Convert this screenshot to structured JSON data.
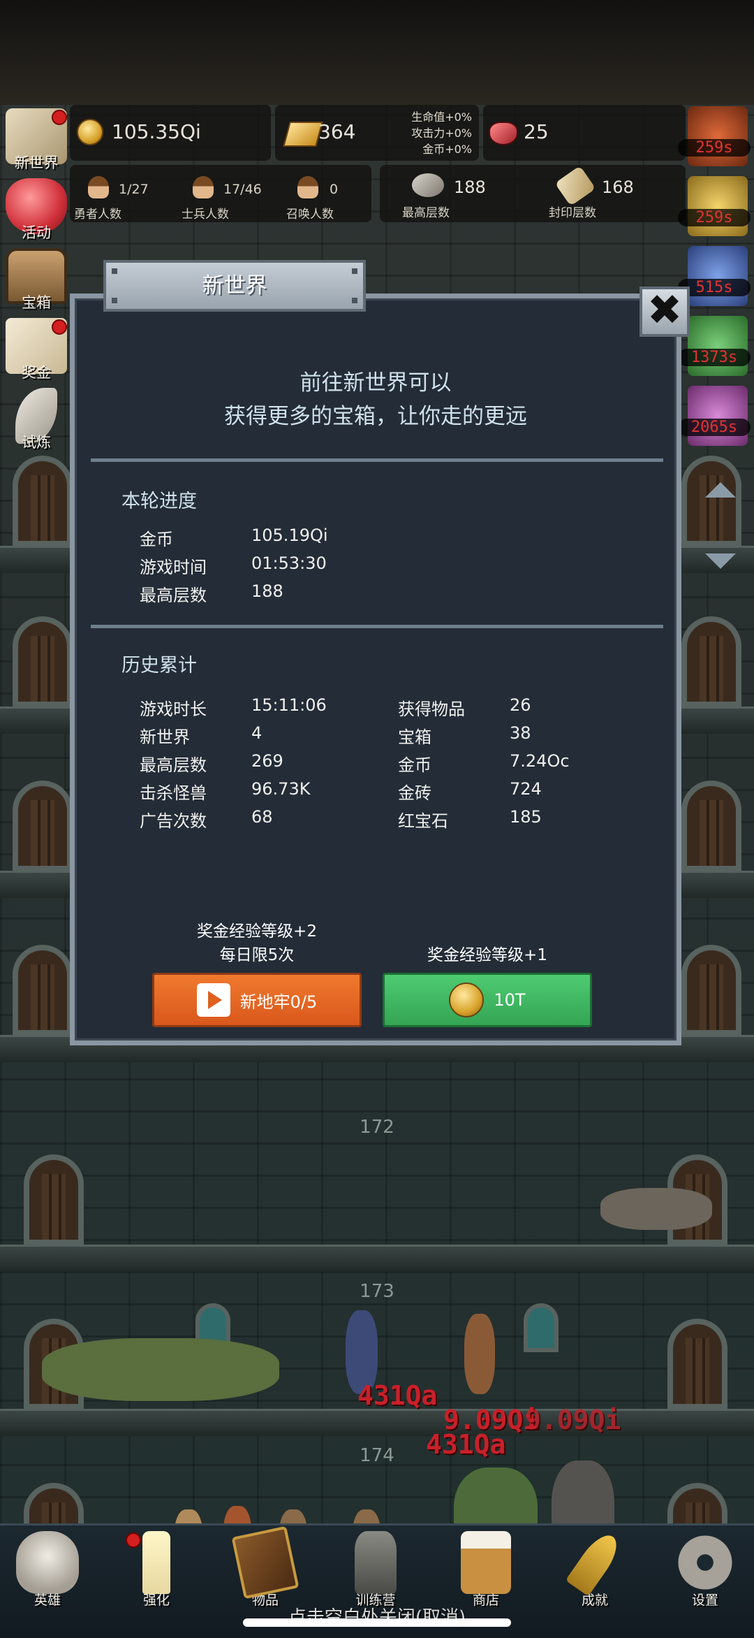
{
  "hud": {
    "coins": "105.35Qi",
    "gold_bars": "364",
    "bonus": [
      "生命值+0%",
      "攻击力+0%",
      "金币+0%"
    ],
    "rubies": "25",
    "heroes": {
      "value": "1/27",
      "label": "勇者人数"
    },
    "soldiers": {
      "value": "17/46",
      "label": "士兵人数"
    },
    "summons": {
      "value": "0",
      "label": "召唤人数"
    },
    "max_floor": {
      "value": "188",
      "label": "最高层数"
    },
    "sealed_floor": {
      "value": "168",
      "label": "封印层数"
    }
  },
  "side_menu": [
    {
      "label": "新世界",
      "icon": "map-icon",
      "dot": true
    },
    {
      "label": "活动",
      "icon": "heart-icon",
      "dot": false
    },
    {
      "label": "宝箱",
      "icon": "chest-icon",
      "dot": false
    },
    {
      "label": "奖金",
      "icon": "letter-icon",
      "dot": true
    },
    {
      "label": "试炼",
      "icon": "feather-icon",
      "dot": false
    }
  ],
  "buffs": [
    {
      "timer": "259s",
      "color": "#a04020"
    },
    {
      "timer": "259s",
      "color": "#b08a2a"
    },
    {
      "timer": "515s",
      "color": "#3c5a9c"
    },
    {
      "timer": "1373s",
      "color": "#3a8a3a"
    },
    {
      "timer": "2065s",
      "color": "#8a3a8a"
    }
  ],
  "dialog": {
    "title": "新世界",
    "close": "✖",
    "intro": [
      "前往新世界可以",
      "获得更多的宝箱，让你走的更远"
    ],
    "current": {
      "title": "本轮进度",
      "rows": [
        {
          "k": "金币",
          "v": "105.19Qi"
        },
        {
          "k": "游戏时间",
          "v": "01:53:30"
        },
        {
          "k": "最高层数",
          "v": "188"
        }
      ]
    },
    "history": {
      "title": "历史累计",
      "left": [
        {
          "k": "游戏时长",
          "v": "15:11:06"
        },
        {
          "k": "新世界",
          "v": "4"
        },
        {
          "k": "最高层数",
          "v": "269"
        },
        {
          "k": "击杀怪兽",
          "v": "96.73K"
        },
        {
          "k": "广告次数",
          "v": "68"
        }
      ],
      "right": [
        {
          "k": "获得物品",
          "v": "26"
        },
        {
          "k": "宝箱",
          "v": "38"
        },
        {
          "k": "金币",
          "v": "7.24Oc"
        },
        {
          "k": "金砖",
          "v": "724"
        },
        {
          "k": "红宝石",
          "v": "185"
        }
      ]
    },
    "ad_note": [
      "奖金经验等级+2",
      "每日限5次"
    ],
    "ad_button": "新地牢0/5",
    "coin_note": "奖金经验等级+1",
    "coin_button": "10T"
  },
  "floors": [
    "172",
    "173",
    "174"
  ],
  "damage": [
    "431Qa",
    "9.09Qi",
    "9.09Qi",
    "431Qa"
  ],
  "nav": [
    {
      "label": "英雄",
      "icon": "skull-icon",
      "dot": false
    },
    {
      "label": "强化",
      "icon": "candle-icon",
      "dot": true
    },
    {
      "label": "物品",
      "icon": "book-icon",
      "dot": false
    },
    {
      "label": "训练营",
      "icon": "lantern-icon",
      "dot": false
    },
    {
      "label": "商店",
      "icon": "mug-icon",
      "dot": false
    },
    {
      "label": "成就",
      "icon": "key-icon",
      "dot": false
    },
    {
      "label": "设置",
      "icon": "gear-icon",
      "dot": false
    }
  ],
  "hint": "点击空白处关闭(取消)"
}
